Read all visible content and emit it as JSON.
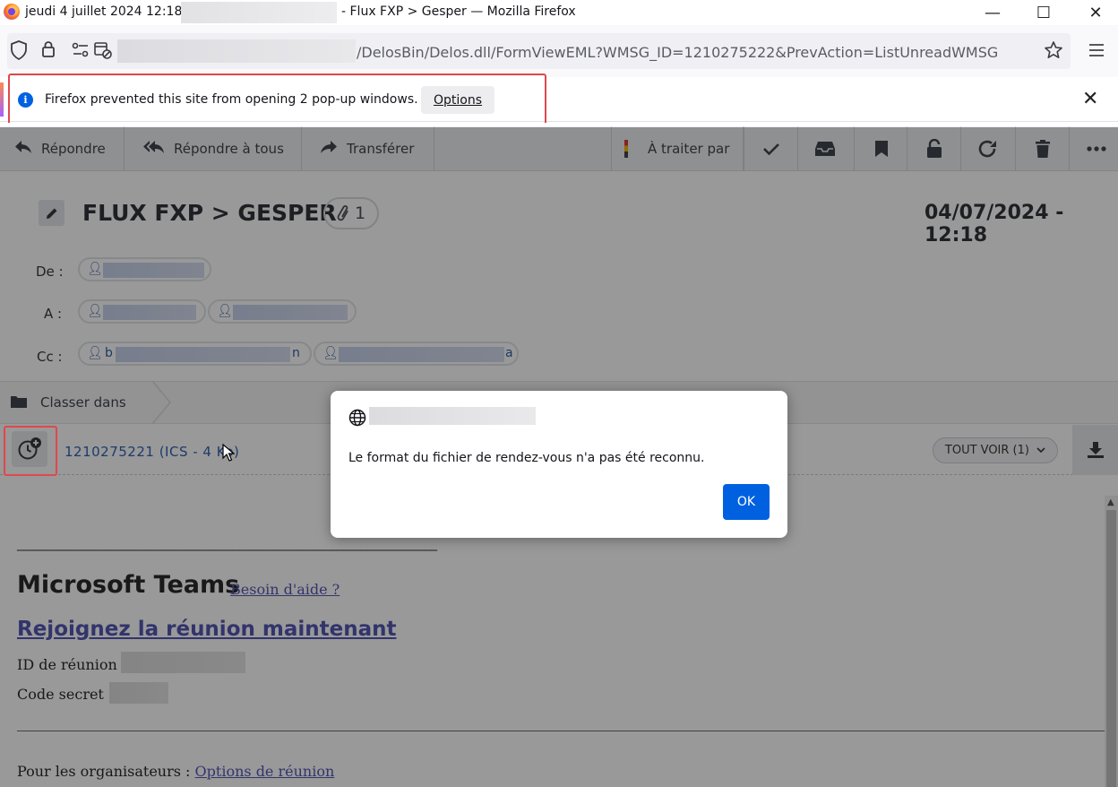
{
  "window": {
    "title_left": "jeudi 4 juillet 2024 12:18 -",
    "title_right": "- Flux FXP > Gesper — Mozilla Firefox",
    "minimize": "—",
    "maximize": "☐",
    "close": "✕"
  },
  "urlbar": {
    "url_visible": "/DelosBin/Delos.dll/FormViewEML?WMSG_ID=1210275222&PrevAction=ListUnreadWMSG"
  },
  "popup_notification": {
    "message": "Firefox prevented this site from opening 2 pop-up windows.",
    "options_label": "Options",
    "close": "✕"
  },
  "toolbar": {
    "reply": "Répondre",
    "reply_all": "Répondre à tous",
    "forward": "Transférer",
    "to_process_by": "À traiter par"
  },
  "message": {
    "subject": "FLUX FXP > GESPER",
    "attachment_count": "1",
    "date": "04/07/2024 - 12:18",
    "from_label": "De :",
    "to_label": "A :",
    "cc_label": "Cc :",
    "cc_first_initial": "b",
    "cc_first_tail": "n",
    "cc_second_tail": "a",
    "classer_label": "Classer dans",
    "attachment_name": "1210275221  (ICS - 4 Ko)",
    "see_all": "TOUT VOIR (1)"
  },
  "body": {
    "separator": "________________________________________________________________________",
    "teams_title": "Microsoft Teams",
    "help_link": "Besoin d'aide ?",
    "join_link": "Rejoignez la réunion maintenant",
    "meeting_id_label": "ID de réunion :",
    "passcode_label": "Code secret :",
    "organizers_label": "Pour les organisateurs :",
    "meeting_options_link": "Options de réunion"
  },
  "dialog": {
    "message": "Le format du fichier de rendez-vous n'a pas été reconnu.",
    "ok_label": "OK"
  },
  "colors": {
    "accent": "#0061e0",
    "highlight_box": "#e0484b",
    "teams_link": "#4f52b2"
  }
}
